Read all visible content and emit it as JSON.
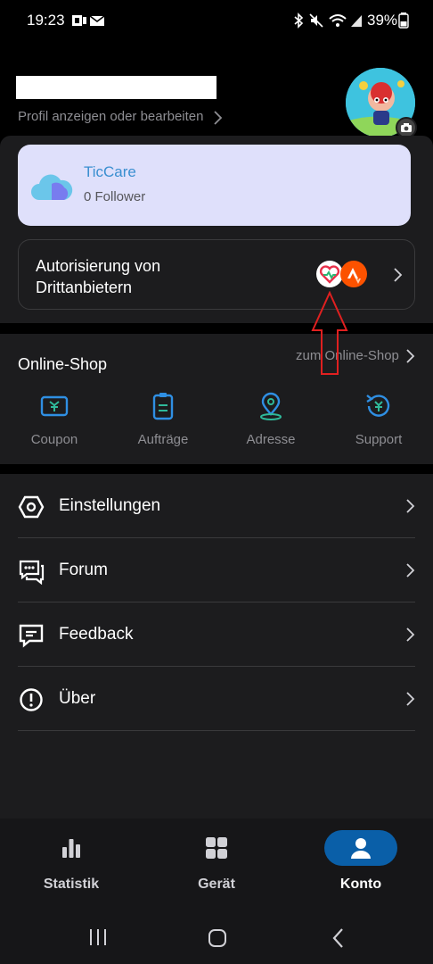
{
  "status_bar": {
    "time": "19:23",
    "battery": "39%"
  },
  "profile": {
    "edit_link": "Profil anzeigen oder bearbeiten"
  },
  "ticcare": {
    "title": "TicCare",
    "followers": "0 Follower"
  },
  "authorization": {
    "title": "Autorisierung von Drittanbietern"
  },
  "shop": {
    "title": "Online-Shop",
    "link": "zum Online-Shop",
    "items": [
      {
        "label": "Coupon",
        "icon": "coupon-icon"
      },
      {
        "label": "Aufträge",
        "icon": "orders-icon"
      },
      {
        "label": "Adresse",
        "icon": "address-icon"
      },
      {
        "label": "Support",
        "icon": "support-icon"
      }
    ]
  },
  "menu": {
    "items": [
      {
        "label": "Einstellungen",
        "icon": "settings-icon"
      },
      {
        "label": "Forum",
        "icon": "forum-icon"
      },
      {
        "label": "Feedback",
        "icon": "feedback-icon"
      },
      {
        "label": "Über",
        "icon": "info-icon"
      }
    ]
  },
  "bottom_nav": {
    "items": [
      {
        "label": "Statistik",
        "icon": "bar-chart-icon"
      },
      {
        "label": "Gerät",
        "icon": "grid-icon"
      },
      {
        "label": "Konto",
        "icon": "person-icon",
        "active": true
      }
    ]
  },
  "colors": {
    "accent": "#0a5fa8",
    "shop_icon": "#2f8fe3",
    "address_icon": "#2fb99a",
    "annotation": "#e02020"
  }
}
